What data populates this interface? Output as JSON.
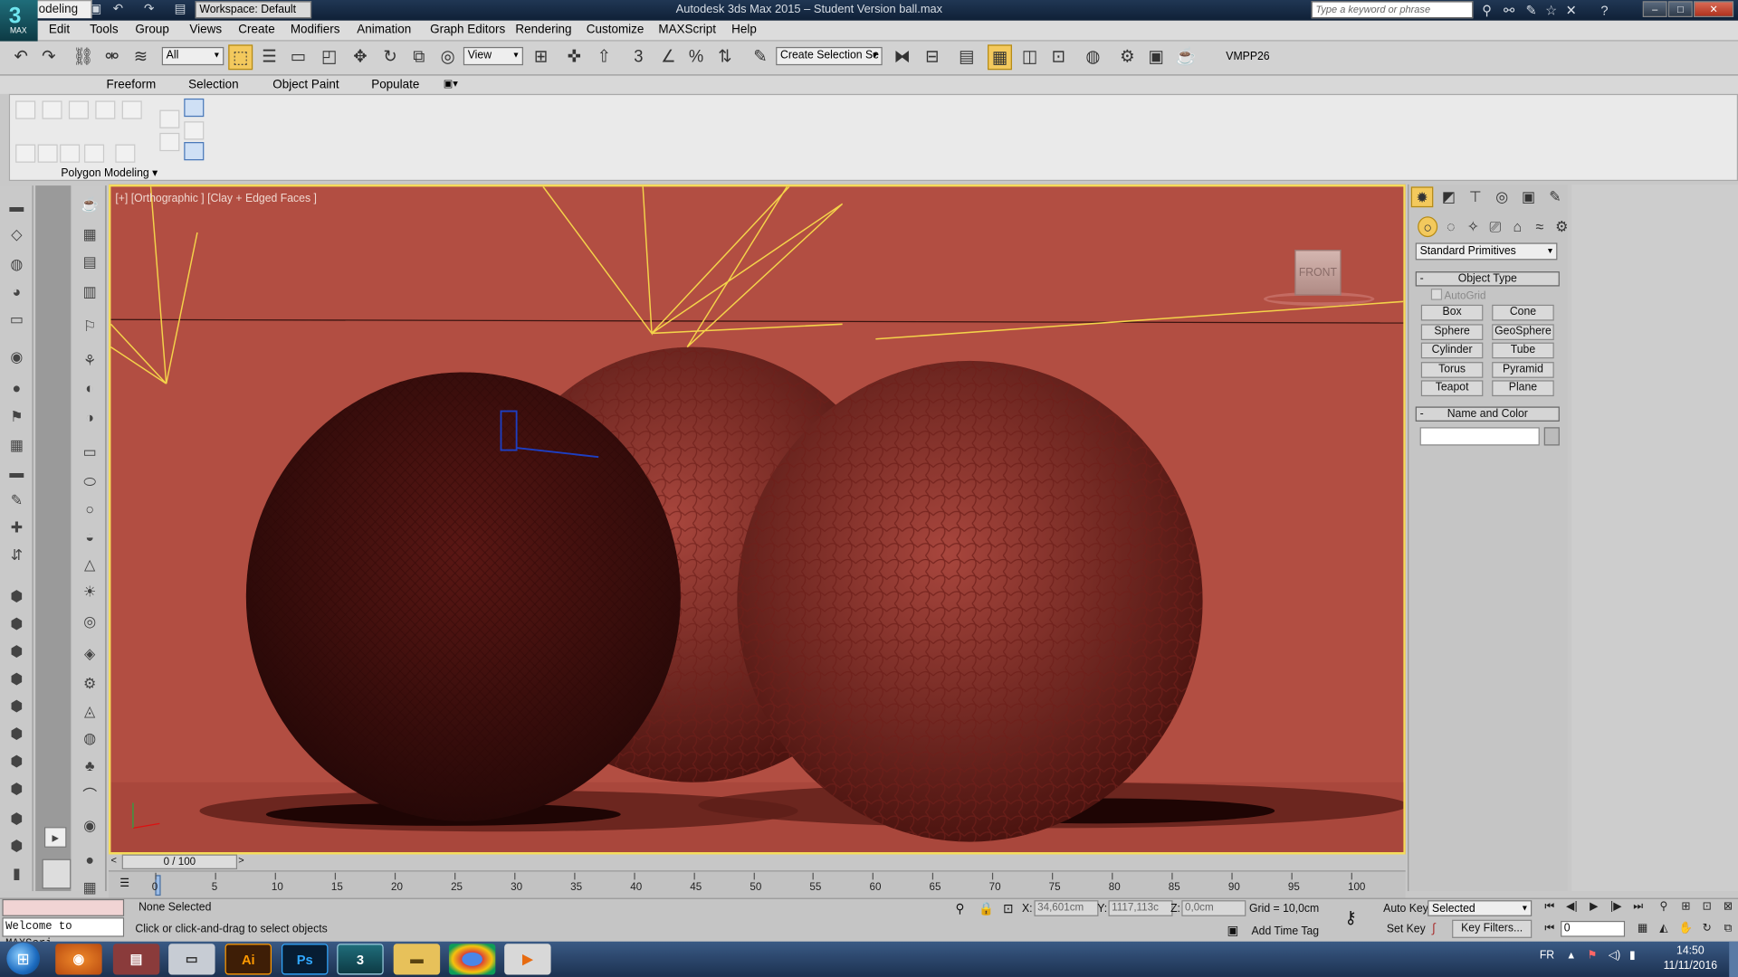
{
  "titlebar": {
    "app_icon_label": "MAX",
    "workspace": "Workspace: Default",
    "window_title": "Autodesk 3ds Max 2015 – Student Version    ball.max",
    "search_placeholder": "Type a keyword or phrase"
  },
  "menu": [
    "Edit",
    "Tools",
    "Group",
    "Views",
    "Create",
    "Modifiers",
    "Animation",
    "Graph Editors",
    "Rendering",
    "Customize",
    "MAXScript",
    "Help"
  ],
  "toolbar": {
    "filter_select": "All",
    "ref_coord": "View",
    "named_selection": "Create Selection Se",
    "angle_snap_label": "3",
    "plugin_label": "VMPP26"
  },
  "ribbon": {
    "tabs": [
      "Modeling",
      "Freeform",
      "Selection",
      "Object Paint",
      "Populate"
    ],
    "active_tab": "Modeling",
    "panel_label": "Polygon Modeling"
  },
  "viewport": {
    "label": "[+] [Orthographic ] [Clay + Edged Faces ]",
    "viewcube": "FRONT"
  },
  "timeline": {
    "slider": "0 / 100",
    "ticks": [
      "0",
      "5",
      "10",
      "15",
      "20",
      "25",
      "30",
      "35",
      "40",
      "45",
      "50",
      "55",
      "60",
      "65",
      "70",
      "75",
      "80",
      "85",
      "90",
      "95",
      "100"
    ]
  },
  "command_panel": {
    "dropdown": "Standard Primitives",
    "object_type_title": "Object Type",
    "autogrid": "AutoGrid",
    "buttons": [
      "Box",
      "Cone",
      "Sphere",
      "GeoSphere",
      "Cylinder",
      "Tube",
      "Torus",
      "Pyramid",
      "Teapot",
      "Plane"
    ],
    "name_color_title": "Name and Color"
  },
  "status": {
    "maxscript": "Welcome to MAXScri",
    "selection": "None Selected",
    "prompt": "Click or click-and-drag to select objects",
    "x_label": "X:",
    "x": "34,601cm",
    "y_label": "Y:",
    "y": "1117,113c",
    "z_label": "Z:",
    "z": "0,0cm",
    "grid": "Grid = 10,0cm",
    "add_time_tag": "Add Time Tag",
    "auto_key": "Auto Key",
    "set_key": "Set Key",
    "key_mode": "Selected",
    "key_filters": "Key Filters...",
    "frame": "0"
  },
  "taskbar": {
    "apps": [
      "Ai",
      "Ps"
    ],
    "lang": "FR",
    "time": "14:50",
    "date": "11/11/2016"
  }
}
